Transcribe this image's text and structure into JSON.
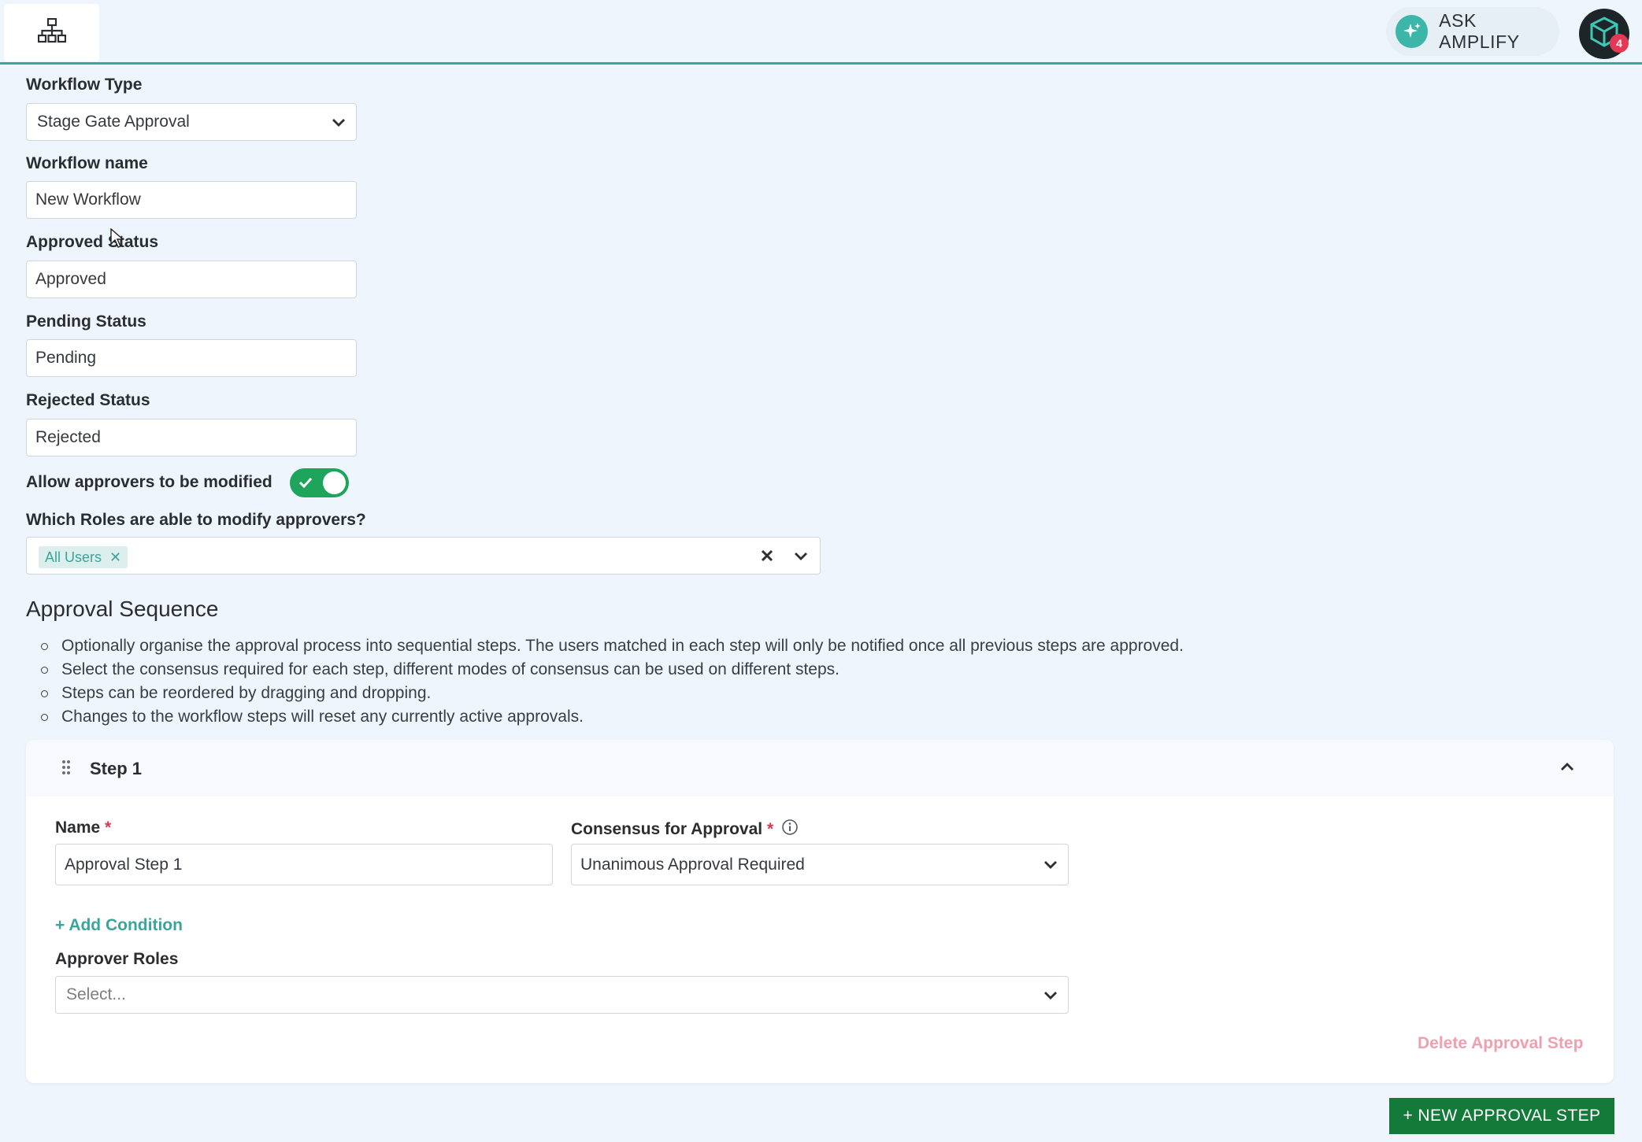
{
  "header": {
    "home_icon": "sitemap-icon",
    "ask_label": "ASK AMPLIFY",
    "ask_icon": "sparkle-icon",
    "avatar_icon": "cube-icon",
    "notification_count": "4"
  },
  "form": {
    "workflow_type_label": "Workflow Type",
    "workflow_type_value": "Stage Gate Approval",
    "workflow_name_label": "Workflow name",
    "workflow_name_value": "New Workflow",
    "approved_status_label": "Approved Status",
    "approved_status_value": "Approved",
    "pending_status_label": "Pending Status",
    "pending_status_value": "Pending",
    "rejected_status_label": "Rejected Status",
    "rejected_status_value": "Rejected",
    "allow_modify_label": "Allow approvers to be modified",
    "allow_modify_on": true,
    "roles_modify_label": "Which Roles are able to modify approvers?",
    "roles_modify_selected": [
      "All Users"
    ]
  },
  "approval_sequence": {
    "title": "Approval Sequence",
    "notes": [
      "Optionally organise the approval process into sequential steps. The users matched in each step will only be notified once all previous steps are approved.",
      "Select the consensus required for each step, different modes of consensus can be used on different steps.",
      "Steps can be reordered by dragging and dropping.",
      "Changes to the workflow steps will reset any currently active approvals."
    ],
    "steps": [
      {
        "title": "Step 1",
        "name_label": "Name",
        "name_value": "Approval Step 1",
        "consensus_label": "Consensus for Approval",
        "consensus_value": "Unanimous Approval Required",
        "add_condition_label": "+ Add Condition",
        "approver_roles_label": "Approver Roles",
        "approver_roles_placeholder": "Select...",
        "delete_label": "Delete Approval Step"
      }
    ],
    "new_step_label": "+ NEW APPROVAL STEP"
  },
  "colors": {
    "accent": "#3aa59a",
    "toggle_on": "#1fa45c",
    "primary_button": "#137a3a",
    "required": "#d83a52",
    "danger_link": "#ef9fb0",
    "background": "#eef5fc"
  }
}
